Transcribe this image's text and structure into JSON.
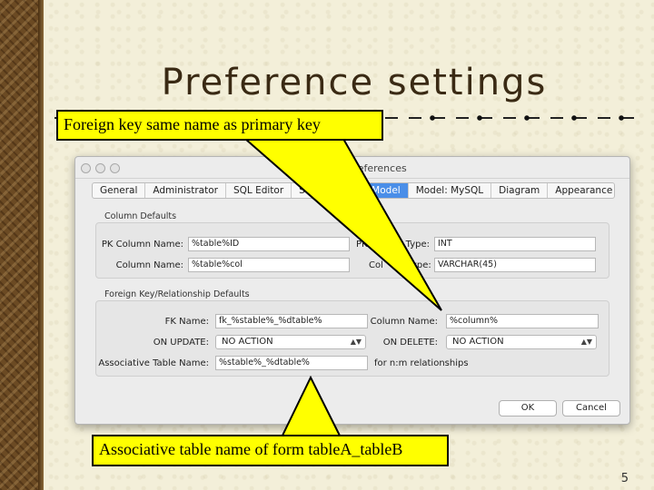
{
  "slide": {
    "title": "Preference settings",
    "page_number": "5"
  },
  "callouts": {
    "top": "Foreign key same name as primary key",
    "bottom": "Associative table name of form tableA_tableB"
  },
  "dialog": {
    "title": "Preferences",
    "tabs": [
      {
        "label": "General"
      },
      {
        "label": "Administrator"
      },
      {
        "label": "SQL Editor"
      },
      {
        "label": "S"
      },
      {
        "label": "Model",
        "active": true
      },
      {
        "label": "Model: MySQL"
      },
      {
        "label": "Diagram"
      },
      {
        "label": "Appearance"
      }
    ],
    "column_defaults": {
      "group_label": "Column Defaults",
      "pk_column_name_label": "PK Column Name:",
      "pk_column_name_value": "%table%ID",
      "pk_column_type_label": "PK",
      "pk_column_type_label_tail": "ing Type:",
      "pk_column_type_value": "INT",
      "column_name_label": "Column Name:",
      "column_name_value": "%table%col",
      "column_type_label": "Col",
      "column_type_label_tail": "ype:",
      "column_type_value": "VARCHAR(45)"
    },
    "fk_defaults": {
      "group_label": "Foreign Key/Relationship Defaults",
      "fk_name_label": "FK Name:",
      "fk_name_value": "fk_%stable%_%dtable%",
      "column_name_label": "Column Name:",
      "column_name_value": "%column%",
      "on_update_label": "ON UPDATE:",
      "on_update_value": "NO ACTION",
      "on_delete_label": "ON DELETE:",
      "on_delete_value": "NO ACTION",
      "assoc_table_label": "Associative Table Name:",
      "assoc_table_value": "%stable%_%dtable%",
      "assoc_table_note": "for n:m relationships"
    },
    "buttons": {
      "ok": "OK",
      "cancel": "Cancel"
    }
  },
  "colors": {
    "callout_bg": "#ffff00",
    "active_tab": "#4a8ee8",
    "title_text": "#3a2a14"
  }
}
